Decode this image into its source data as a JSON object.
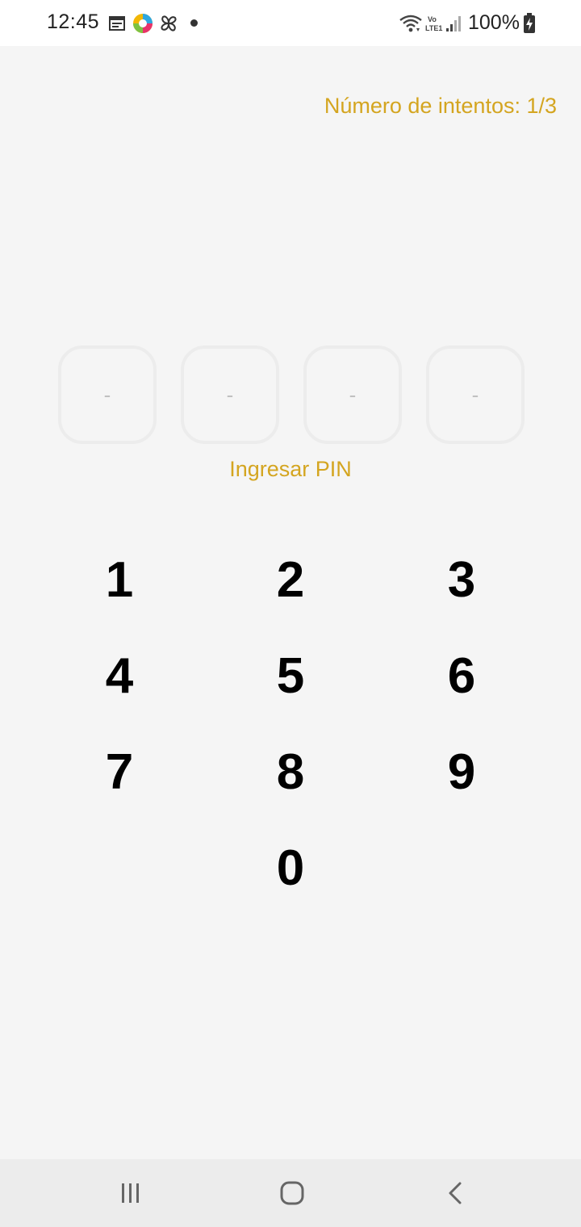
{
  "status_bar": {
    "time": "12:45",
    "battery": "100%",
    "icons": [
      "calendar-icon",
      "photos-app-icon",
      "pinwheel-app-icon",
      "notification-dot",
      "wifi-icon",
      "volte-icon",
      "signal-icon",
      "battery-charging-icon"
    ]
  },
  "attempts_label": "Número de intentos: 1/3",
  "pin": {
    "slots": [
      "-",
      "-",
      "-",
      "-"
    ],
    "label": "Ingresar PIN"
  },
  "keypad": {
    "keys": [
      "1",
      "2",
      "3",
      "4",
      "5",
      "6",
      "7",
      "8",
      "9",
      "0"
    ]
  },
  "nav_bar": {
    "icons": [
      "recent-apps-icon",
      "home-icon",
      "back-icon"
    ]
  },
  "colors": {
    "accent": "#d4a520",
    "background": "#f5f5f5",
    "pin_box_border": "#ececec"
  }
}
